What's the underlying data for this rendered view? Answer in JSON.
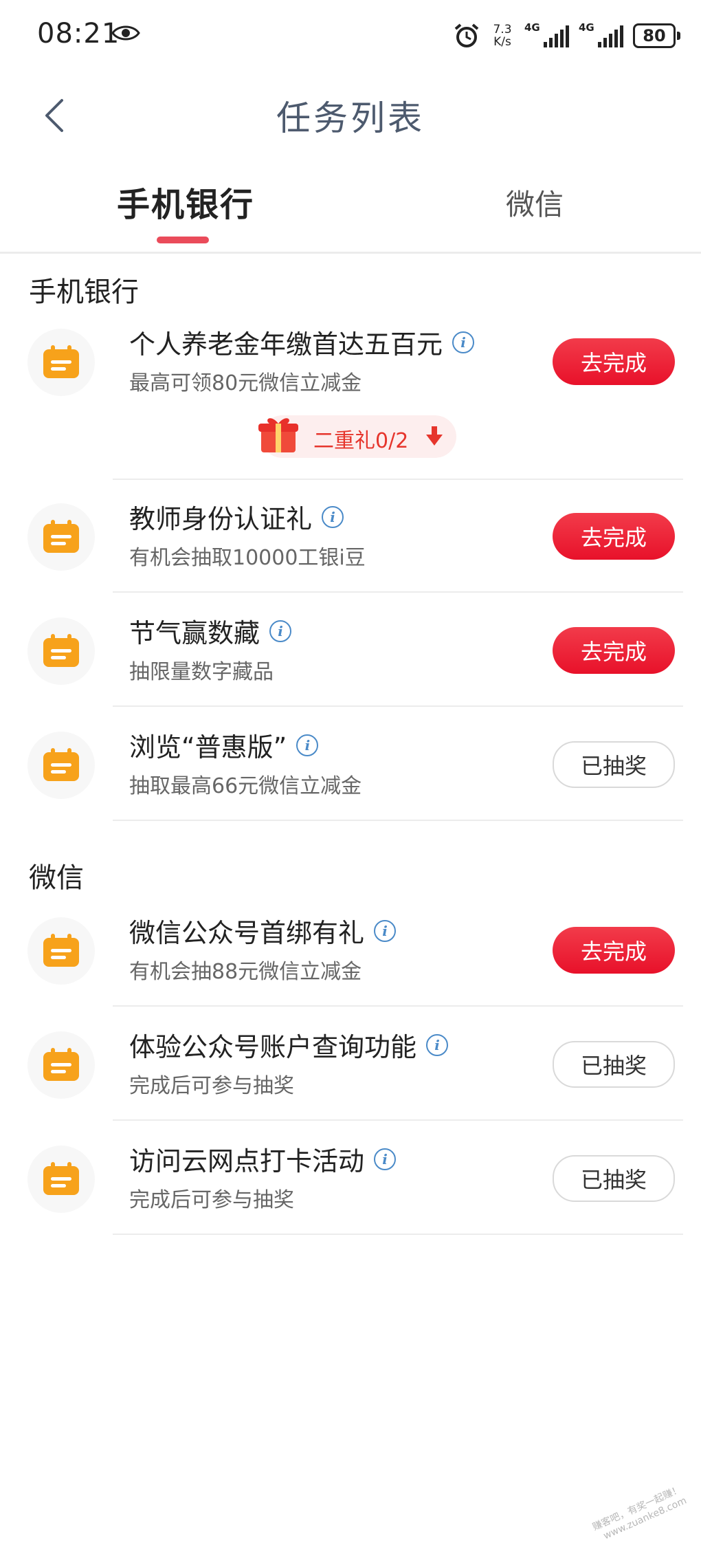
{
  "status_bar": {
    "time": "08:21",
    "network_speed_value": "7.3",
    "network_speed_unit": "K/s",
    "signal1_label": "4G",
    "signal2_label": "4G",
    "battery": "80"
  },
  "header": {
    "title": "任务列表"
  },
  "tabs": [
    {
      "label": "手机银行",
      "active": true
    },
    {
      "label": "微信",
      "active": false
    }
  ],
  "sections": [
    {
      "title": "手机银行",
      "tasks": [
        {
          "name": "个人养老金年缴首达五百元",
          "desc": "最高可领80元微信立减金",
          "button": "去完成",
          "status": "todo"
        },
        {
          "name": "教师身份认证礼",
          "desc": "有机会抽取10000工银i豆",
          "button": "去完成",
          "status": "todo"
        },
        {
          "name": "节气赢数藏",
          "desc": "抽限量数字藏品",
          "button": "去完成",
          "status": "todo"
        },
        {
          "name": "浏览“普惠版”",
          "desc": "抽取最高66元微信立减金",
          "button": "已抽奖",
          "status": "done"
        }
      ]
    },
    {
      "title": "微信",
      "tasks": [
        {
          "name": "微信公众号首绑有礼",
          "desc": "有机会抽88元微信立减金",
          "button": "去完成",
          "status": "todo"
        },
        {
          "name": "体验公众号账户查询功能",
          "desc": "完成后可参与抽奖",
          "button": "已抽奖",
          "status": "done"
        },
        {
          "name": "访问云网点打卡活动",
          "desc": "完成后可参与抽奖",
          "button": "已抽奖",
          "status": "done"
        }
      ]
    }
  ],
  "gift": {
    "label": "二重礼0/2"
  },
  "watermark": {
    "line1": "赚客吧，有奖一起赚！",
    "line2": "www.zuanke8.com"
  },
  "colors": {
    "accent": "#e8112a",
    "tab_indicator": "#ea4b5a",
    "icon_orange": "#f7a21b",
    "info_blue": "#4a8ac8"
  }
}
